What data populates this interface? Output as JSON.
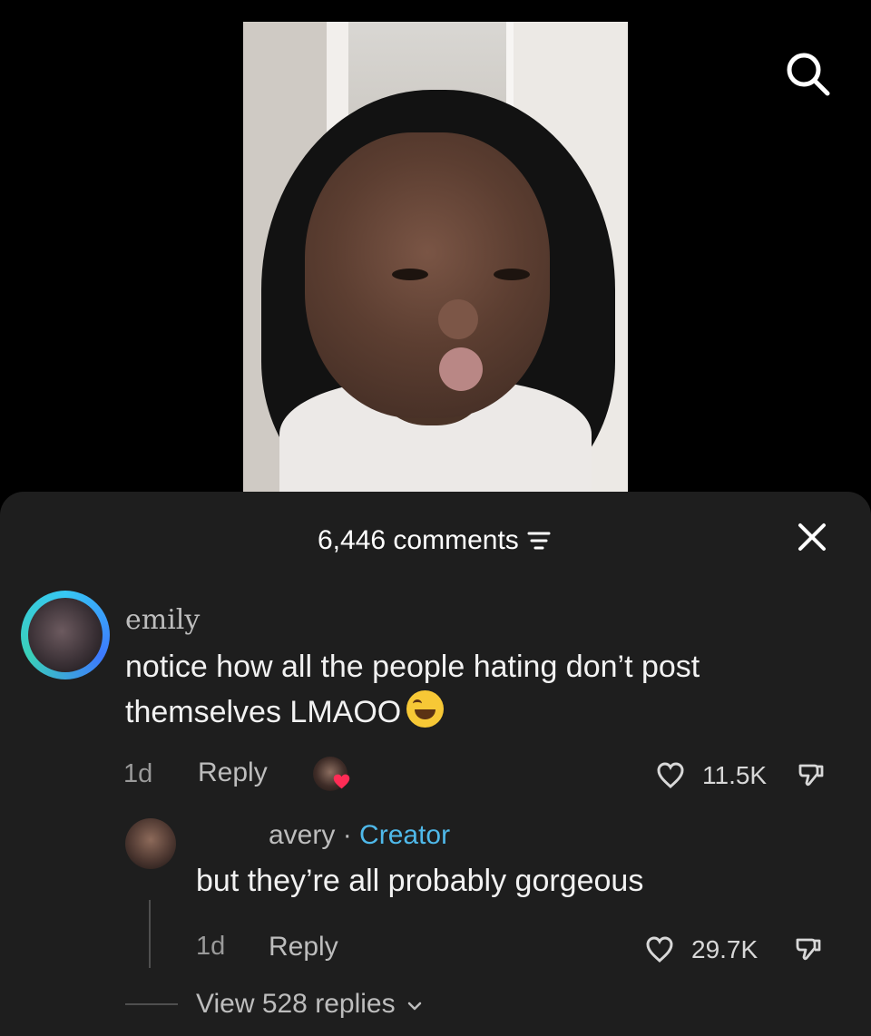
{
  "comments": {
    "header": "6,446 comments",
    "main": {
      "author": "emily",
      "text": "notice how all the people hating don’t post themselves LMAOO",
      "time": "1d",
      "reply_label": "Reply",
      "likes": "11.5K"
    },
    "reply": {
      "author": "avery",
      "separator": "·",
      "badge": "Creator",
      "text": "but they’re all probably gorgeous",
      "time": "1d",
      "reply_label": "Reply",
      "likes": "29.7K"
    },
    "view_replies": "View 528 replies"
  },
  "colors": {
    "sheet_background": "#1e1e1e",
    "creator_badge": "#4fb9ea",
    "like_heart_badge": "#fe2c55"
  },
  "icons": {
    "search": "search-icon",
    "sort": "sort-icon",
    "close": "close-icon",
    "emoji": "laughing-emoji-icon",
    "heart": "heart-icon",
    "dislike": "dislike-icon",
    "chevron": "chevron-down-icon"
  }
}
